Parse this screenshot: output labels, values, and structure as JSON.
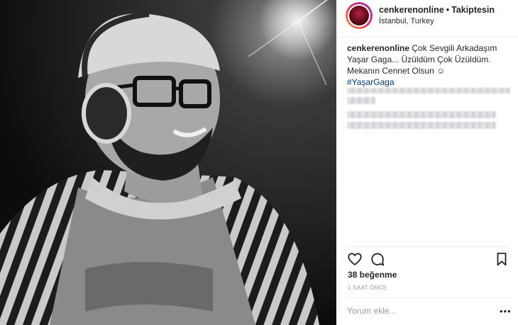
{
  "post": {
    "username": "cenkerenonline",
    "separator": "•",
    "follow_label": "Takiptesin",
    "location": "İstanbul, Turkey",
    "caption_username": "cenkerenonline",
    "caption_text": "Çok Sevgili Arkadaşım Yaşar Gaga... Üzüldüm Çok Üzüldüm. Mekanın Cennet Olsun ☺",
    "hashtag": "#YaşarGaga",
    "likes": "38 beğenme",
    "time": "1 SAAT ÖNCE",
    "comment_placeholder": "Yorum ekle...",
    "more_label": "•••"
  },
  "icons": {
    "like": "heart-icon",
    "comment": "comment-icon",
    "save": "bookmark-icon",
    "more": "more-options-icon"
  }
}
